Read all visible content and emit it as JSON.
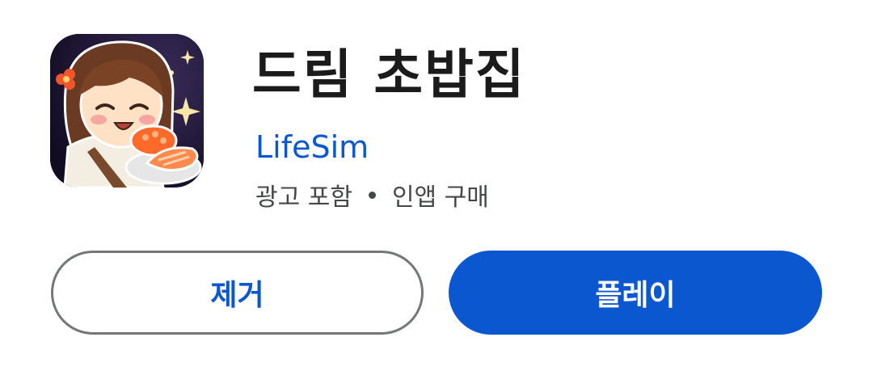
{
  "app": {
    "title": "드림 초밥집",
    "developer": "LifeSim",
    "meta": {
      "ads": "광고 포함",
      "iap": "인앱 구매"
    },
    "icon": "sushi-chef-app-icon"
  },
  "actions": {
    "uninstall_label": "제거",
    "play_label": "플레이"
  },
  "colors": {
    "accent": "#0b57d0",
    "title_text": "#1b1b1b",
    "secondary_text": "#444746",
    "outline": "#747775"
  }
}
